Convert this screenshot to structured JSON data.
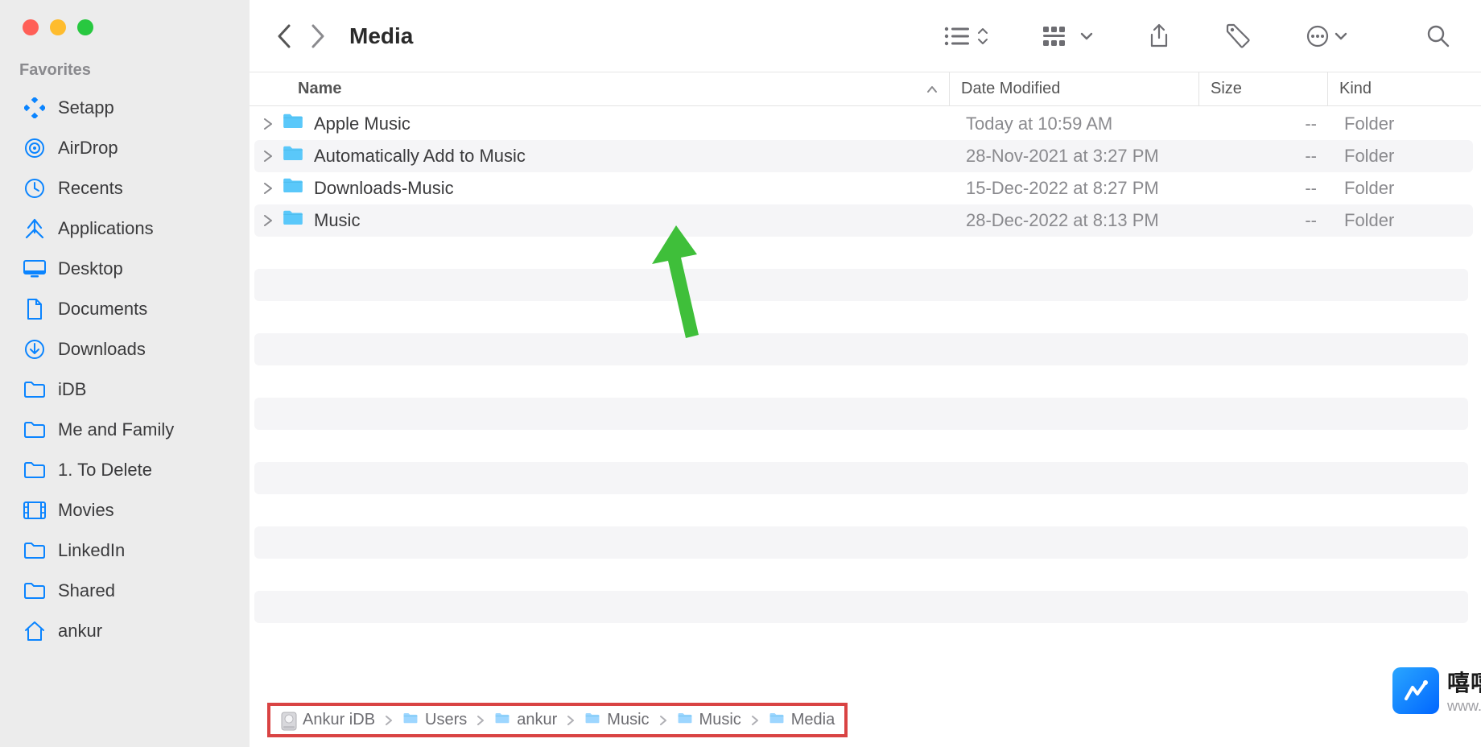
{
  "toolbar": {
    "title": "Media"
  },
  "sidebar": {
    "section": "Favorites",
    "items": [
      {
        "label": "Setapp",
        "icon": "setapp"
      },
      {
        "label": "AirDrop",
        "icon": "airdrop"
      },
      {
        "label": "Recents",
        "icon": "clock"
      },
      {
        "label": "Applications",
        "icon": "apps"
      },
      {
        "label": "Desktop",
        "icon": "desktop"
      },
      {
        "label": "Documents",
        "icon": "document"
      },
      {
        "label": "Downloads",
        "icon": "download"
      },
      {
        "label": "iDB",
        "icon": "folder"
      },
      {
        "label": "Me and Family",
        "icon": "folder"
      },
      {
        "label": "1. To Delete",
        "icon": "folder"
      },
      {
        "label": "Movies",
        "icon": "movies"
      },
      {
        "label": "LinkedIn",
        "icon": "folder"
      },
      {
        "label": "Shared",
        "icon": "folder"
      },
      {
        "label": "ankur",
        "icon": "home"
      }
    ]
  },
  "columns": {
    "name": "Name",
    "date": "Date Modified",
    "size": "Size",
    "kind": "Kind"
  },
  "rows": [
    {
      "name": "Apple Music",
      "date": "Today at 10:59 AM",
      "size": "--",
      "kind": "Folder"
    },
    {
      "name": "Automatically Add to Music",
      "date": "28-Nov-2021 at 3:27 PM",
      "size": "--",
      "kind": "Folder"
    },
    {
      "name": "Downloads-Music",
      "date": "15-Dec-2022 at 8:27 PM",
      "size": "--",
      "kind": "Folder"
    },
    {
      "name": "Music",
      "date": "28-Dec-2022 at 8:13 PM",
      "size": "--",
      "kind": "Folder"
    }
  ],
  "path": [
    "Ankur iDB",
    "Users",
    "ankur",
    "Music",
    "Music",
    "Media"
  ],
  "watermark": {
    "name": "嘻嘻笔记",
    "url": "www.bijixx.com"
  }
}
